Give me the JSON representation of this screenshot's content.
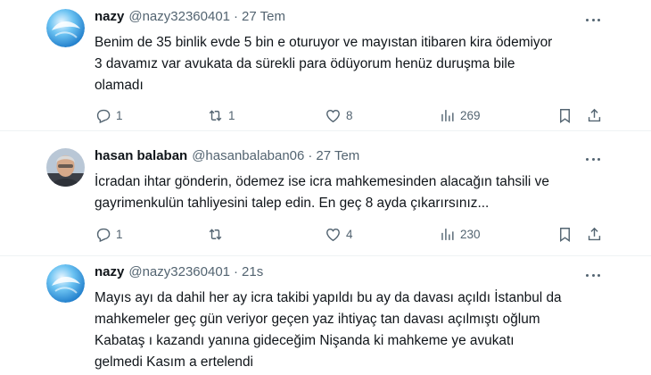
{
  "tweets": [
    {
      "name": "nazy",
      "handle": "@nazy32360401",
      "separator": "·",
      "time": "27 Tem",
      "lines": [
        "Benim de 35 binlik evde 5 bin e oturuyor ve mayıstan itibaren kira ödemiyor",
        "3 davamız var avukata da sürekli para ödüyorum henüz duruşma bile",
        "olamadı"
      ],
      "replies": "1",
      "retweets": "1",
      "likes": "8",
      "views": "269"
    },
    {
      "name": "hasan balaban",
      "handle": "@hasanbalaban06",
      "separator": "·",
      "time": "27 Tem",
      "lines": [
        "İcradan ihtar gönderin, ödemez ise icra mahkemesinden alacağın tahsili ve",
        "gayrimenkulün tahliyesini talep edin. En geç 8 ayda çıkarırsınız..."
      ],
      "replies": "1",
      "retweets": "",
      "likes": "4",
      "views": "230"
    },
    {
      "name": "nazy",
      "handle": "@nazy32360401",
      "separator": "·",
      "time": "21s",
      "lines": [
        "Mayıs ayı da dahil her ay icra takibi yapıldı bu ay da davası açıldı İstanbul da",
        "mahkemeler geç gün veriyor geçen yaz ihtiyaç tan davası açılmıştı oğlum",
        "Kabataş ı kazandı yanına gideceğim Nişanda ki mahkeme ye avukatı",
        "gelmedi Kasım a ertelendi"
      ]
    }
  ],
  "icons": {
    "reply": "reply-icon",
    "retweet": "retweet-icon",
    "like": "heart-icon",
    "views": "views-icon",
    "bookmark": "bookmark-icon",
    "share": "share-icon",
    "more": "more-icon"
  },
  "colors": {
    "text": "#0f1419",
    "secondary": "#536471",
    "divider": "#eff3f4"
  }
}
